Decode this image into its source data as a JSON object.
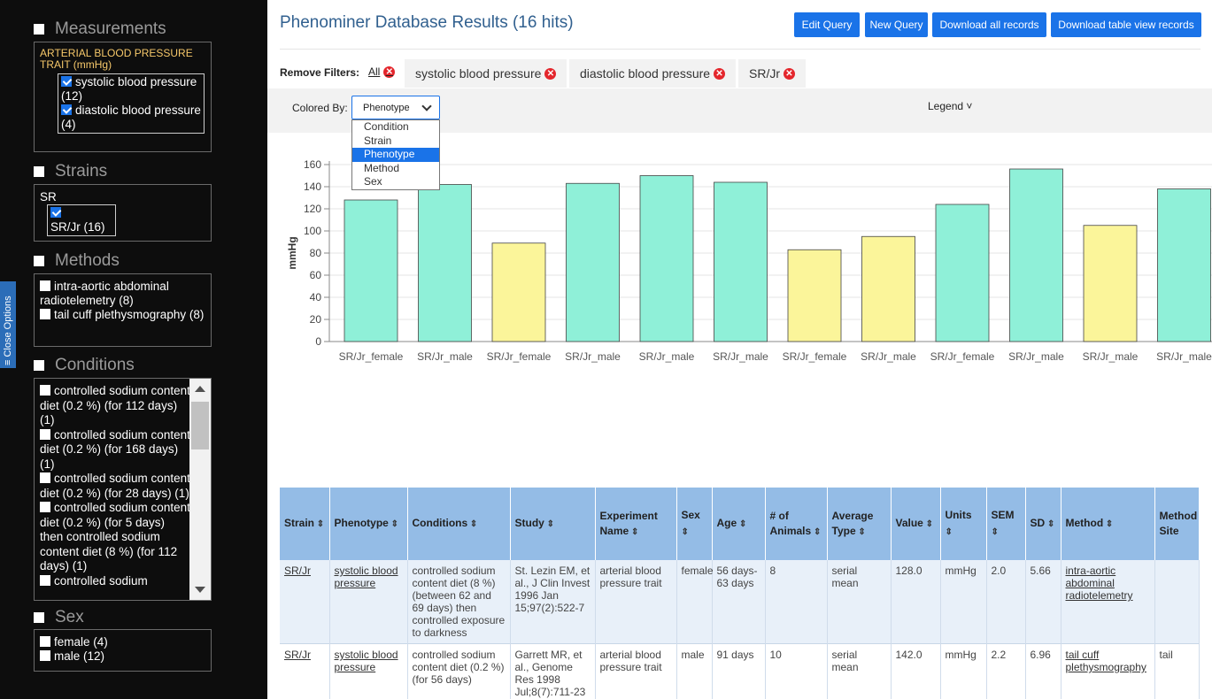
{
  "sidebar": {
    "close_tab": "≡ Close Options",
    "measurements": {
      "title": "Measurements",
      "trait": "ARTERIAL BLOOD PRESSURE TRAIT (mmHg)",
      "items": [
        {
          "label": "systolic blood pressure (12)",
          "checked": true
        },
        {
          "label": "diastolic blood pressure (4)",
          "checked": true
        }
      ]
    },
    "strains": {
      "title": "Strains",
      "group": "SR",
      "items": [
        {
          "label": "SR/Jr (16)",
          "checked": true
        }
      ]
    },
    "methods": {
      "title": "Methods",
      "items": [
        {
          "label": "intra-aortic abdominal radiotelemetry (8)"
        },
        {
          "label": "tail cuff plethysmography (8)"
        }
      ]
    },
    "conditions": {
      "title": "Conditions",
      "items": [
        {
          "label": "controlled sodium content diet (0.2 %) (for 112 days)  (1)"
        },
        {
          "label": "controlled sodium content diet (0.2 %) (for 168 days)  (1)"
        },
        {
          "label": "controlled sodium content diet (0.2 %) (for 28 days)  (1)"
        },
        {
          "label": "controlled sodium content diet (0.2 %) (for 5 days) then controlled sodium content diet (8 %) (for 112 days)  (1)"
        },
        {
          "label": "controlled sodium"
        }
      ]
    },
    "sex": {
      "title": "Sex",
      "items": [
        {
          "label": "female (4)"
        },
        {
          "label": "male (12)"
        }
      ]
    }
  },
  "header": {
    "title": "Phenominer Database Results (16 hits)",
    "buttons": [
      "Edit Query",
      "New Query",
      "Download all records",
      "Download table view records"
    ]
  },
  "filters": {
    "label": "Remove Filters:",
    "all": "All",
    "chips": [
      "systolic blood pressure",
      "diastolic blood pressure",
      "SR/Jr"
    ]
  },
  "colored_by": {
    "label": "Colored By:",
    "selected": "Phenotype",
    "options": [
      "Condition",
      "Strain",
      "Phenotype",
      "Method",
      "Sex"
    ],
    "legend": "Legend"
  },
  "chart_data": {
    "type": "bar",
    "ylabel": "mmHg",
    "ylim": [
      0,
      160
    ],
    "yticks": [
      0,
      20,
      40,
      60,
      80,
      100,
      120,
      140,
      160
    ],
    "categories": [
      "SR/Jr_female",
      "SR/Jr_male",
      "SR/Jr_female",
      "SR/Jr_male",
      "SR/Jr_male",
      "SR/Jr_male",
      "SR/Jr_female",
      "SR/Jr_male",
      "SR/Jr_female",
      "SR/Jr_male",
      "SR/Jr_male",
      "SR/Jr_male"
    ],
    "values": [
      128,
      142,
      89,
      143,
      150,
      144,
      83,
      95,
      124,
      156,
      105,
      138
    ],
    "phenotype": [
      "systolic",
      "systolic",
      "diastolic",
      "systolic",
      "systolic",
      "systolic",
      "diastolic",
      "diastolic",
      "systolic",
      "systolic",
      "diastolic",
      "systolic"
    ],
    "colors": {
      "systolic": "#8ff0d8",
      "diastolic": "#fbf59a"
    }
  },
  "table": {
    "headers": [
      "Strain",
      "Phenotype",
      "Conditions",
      "Study",
      "Experiment Name",
      "Sex",
      "Age",
      "# of Animals",
      "Average Type",
      "Value",
      "Units",
      "SEM",
      "SD",
      "Method",
      "Method Site"
    ],
    "rows": [
      [
        "SR/Jr",
        "systolic blood pressure",
        "controlled sodium content diet (8 %) (between 62 and 69 days) then controlled exposure to darkness",
        "St. Lezin EM, et al., J Clin Invest 1996 Jan 15;97(2):522-7",
        "arterial blood pressure trait",
        "female",
        "56 days-63 days",
        "8",
        "serial mean",
        "128.0",
        "mmHg",
        "2.0",
        "5.66",
        "intra-aortic abdominal radiotelemetry",
        ""
      ],
      [
        "SR/Jr",
        "systolic blood pressure",
        "controlled sodium content diet (0.2 %) (for 56 days)",
        "Garrett MR, et al., Genome Res 1998 Jul;8(7):711-23",
        "arterial blood pressure trait",
        "male",
        "91 days",
        "10",
        "serial mean",
        "142.0",
        "mmHg",
        "2.2",
        "6.96",
        "tail cuff plethysmography",
        "tail"
      ]
    ]
  }
}
